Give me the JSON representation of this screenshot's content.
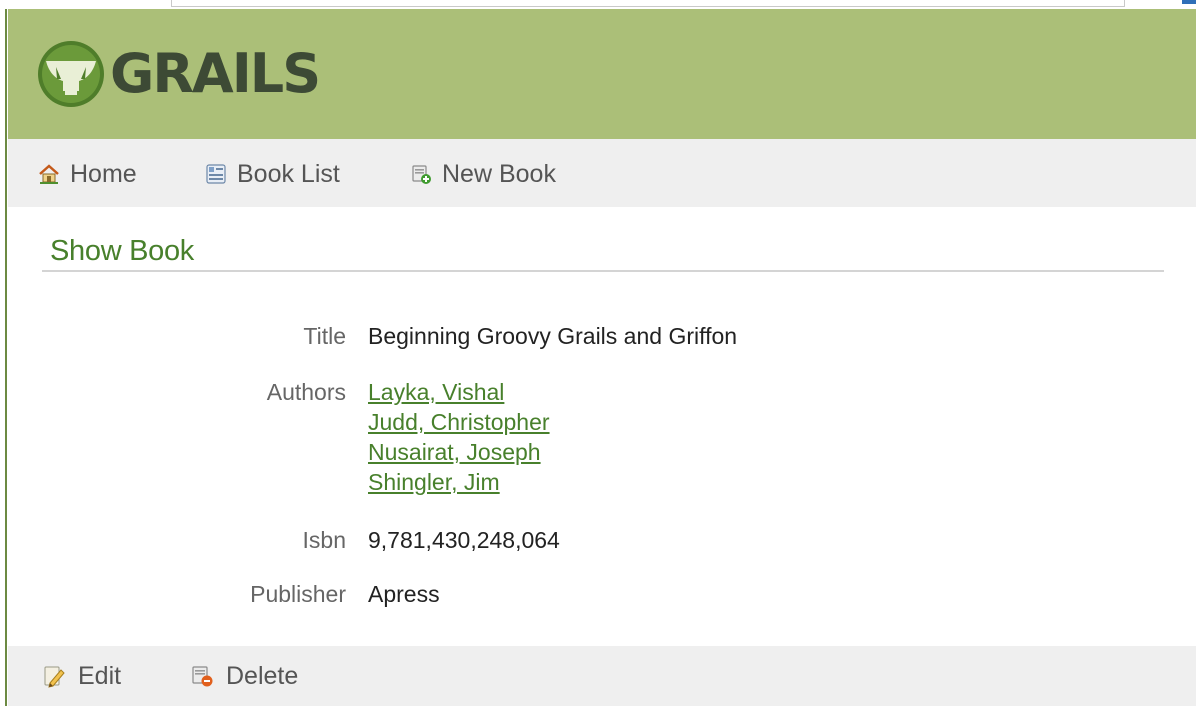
{
  "brand": {
    "logo_text": "GRAILS",
    "colors": {
      "header_green": "#abbf78",
      "link_green": "#48802c",
      "logo_dark": "#3d4a35"
    }
  },
  "nav": {
    "items": [
      {
        "label": "Home",
        "icon": "home-icon"
      },
      {
        "label": "Book List",
        "icon": "list-icon"
      },
      {
        "label": "New Book",
        "icon": "new-book-icon"
      }
    ]
  },
  "main": {
    "heading": "Show Book",
    "fields": {
      "title": {
        "label": "Title",
        "value": "Beginning Groovy Grails and Griffon"
      },
      "authors": {
        "label": "Authors",
        "values": [
          "Layka, Vishal",
          "Judd, Christopher",
          "Nusairat, Joseph",
          "Shingler, Jim"
        ]
      },
      "isbn": {
        "label": "Isbn",
        "value": "9,781,430,248,064"
      },
      "publisher": {
        "label": "Publisher",
        "value": "Apress"
      }
    }
  },
  "actions": {
    "edit_label": "Edit",
    "delete_label": "Delete"
  }
}
